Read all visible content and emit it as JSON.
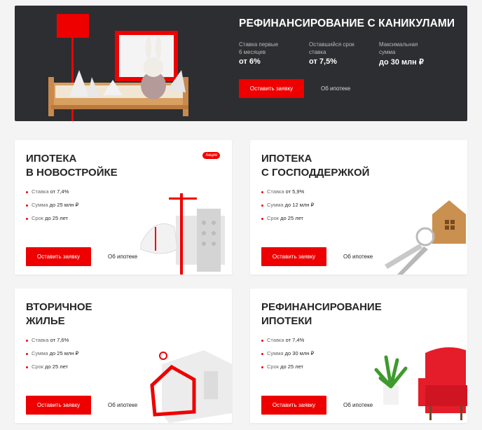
{
  "hero": {
    "title": "Рефинансирование\nс каникулами",
    "stats": [
      {
        "label": "Ставка первые\n6 месяцев",
        "value": "от 6%"
      },
      {
        "label": "Оставшийся срок\nставка",
        "value": "от 7,5%"
      },
      {
        "label": "Максимальная\nсумма",
        "value": "до 30 млн ₽"
      }
    ],
    "apply_label": "Оставить заявку",
    "about_label": "Об ипотеке"
  },
  "cards": [
    {
      "title": "Ипотека\nв новостройке",
      "badge": "Акция",
      "items": [
        {
          "label": "Ставка",
          "value": "от 7,4%"
        },
        {
          "label": "Сумма",
          "value": "до 25 млн ₽"
        },
        {
          "label": "Срок",
          "value": "до 25 лет"
        }
      ],
      "apply_label": "Оставить заявку",
      "about_label": "Об ипотеке"
    },
    {
      "title": "Ипотека\nс господдержкой",
      "items": [
        {
          "label": "Ставка",
          "value": "от 5,9%"
        },
        {
          "label": "Сумма",
          "value": "до 12 млн ₽"
        },
        {
          "label": "Срок",
          "value": "до 25 лет"
        }
      ],
      "apply_label": "Оставить заявку",
      "about_label": "Об ипотеке"
    },
    {
      "title": "Вторичное\nжилье",
      "items": [
        {
          "label": "Ставка",
          "value": "от 7,6%"
        },
        {
          "label": "Сумма",
          "value": "до 25 млн ₽"
        },
        {
          "label": "Срок",
          "value": "до 25 лет"
        }
      ],
      "apply_label": "Оставить заявку",
      "about_label": "Об ипотеке"
    },
    {
      "title": "Рефинансирование\nипотеки",
      "items": [
        {
          "label": "Ставка",
          "value": "от 7,4%"
        },
        {
          "label": "Сумма",
          "value": "до 30 млн ₽"
        },
        {
          "label": "Срок",
          "value": "до 25 лет"
        }
      ],
      "apply_label": "Оставить заявку",
      "about_label": "Об ипотеке"
    }
  ],
  "colors": {
    "accent": "#ee0000",
    "hero_bg": "#2d2e31",
    "page_bg": "#f4f4f4"
  },
  "icons": [
    "bed-toy-illustration",
    "crane-construction-illustration",
    "keys-house-illustration",
    "house-frame-illustration",
    "armchair-plant-illustration"
  ]
}
